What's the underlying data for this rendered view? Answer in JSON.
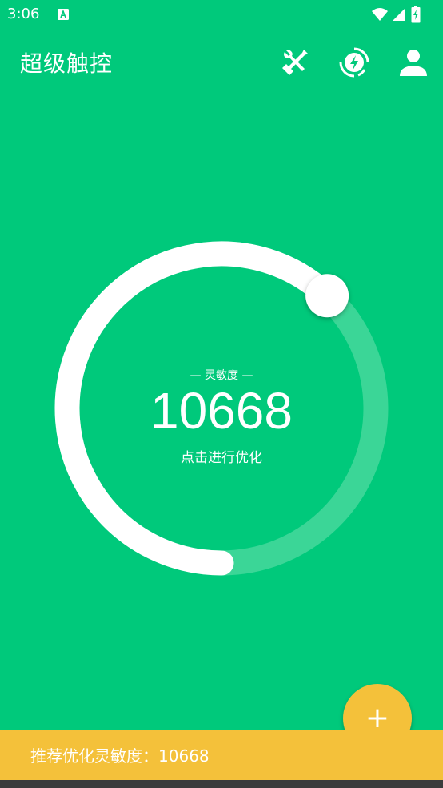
{
  "status_bar": {
    "time": "3:06",
    "notification_icon": "a-letter-icon",
    "icons": [
      "wifi-icon",
      "cell-signal-icon",
      "battery-charging-icon"
    ]
  },
  "app_bar": {
    "title": "超级触控",
    "actions": [
      {
        "name": "tools",
        "icon": "wrench-screwdriver-icon"
      },
      {
        "name": "boost",
        "icon": "lightning-circle-icon"
      },
      {
        "name": "account",
        "icon": "person-icon"
      }
    ]
  },
  "dial": {
    "label": "— 灵敏度 —",
    "value": "10668",
    "action_text": "点击进行优化",
    "progress": 0.62
  },
  "fab": {
    "icon": "plus-icon",
    "label": "+"
  },
  "snackbar": {
    "text": "推荐优化灵敏度：10668"
  },
  "colors": {
    "background": "#00c97b",
    "accent": "#f4c13a",
    "track": "#3bd697",
    "foreground": "#ffffff"
  }
}
